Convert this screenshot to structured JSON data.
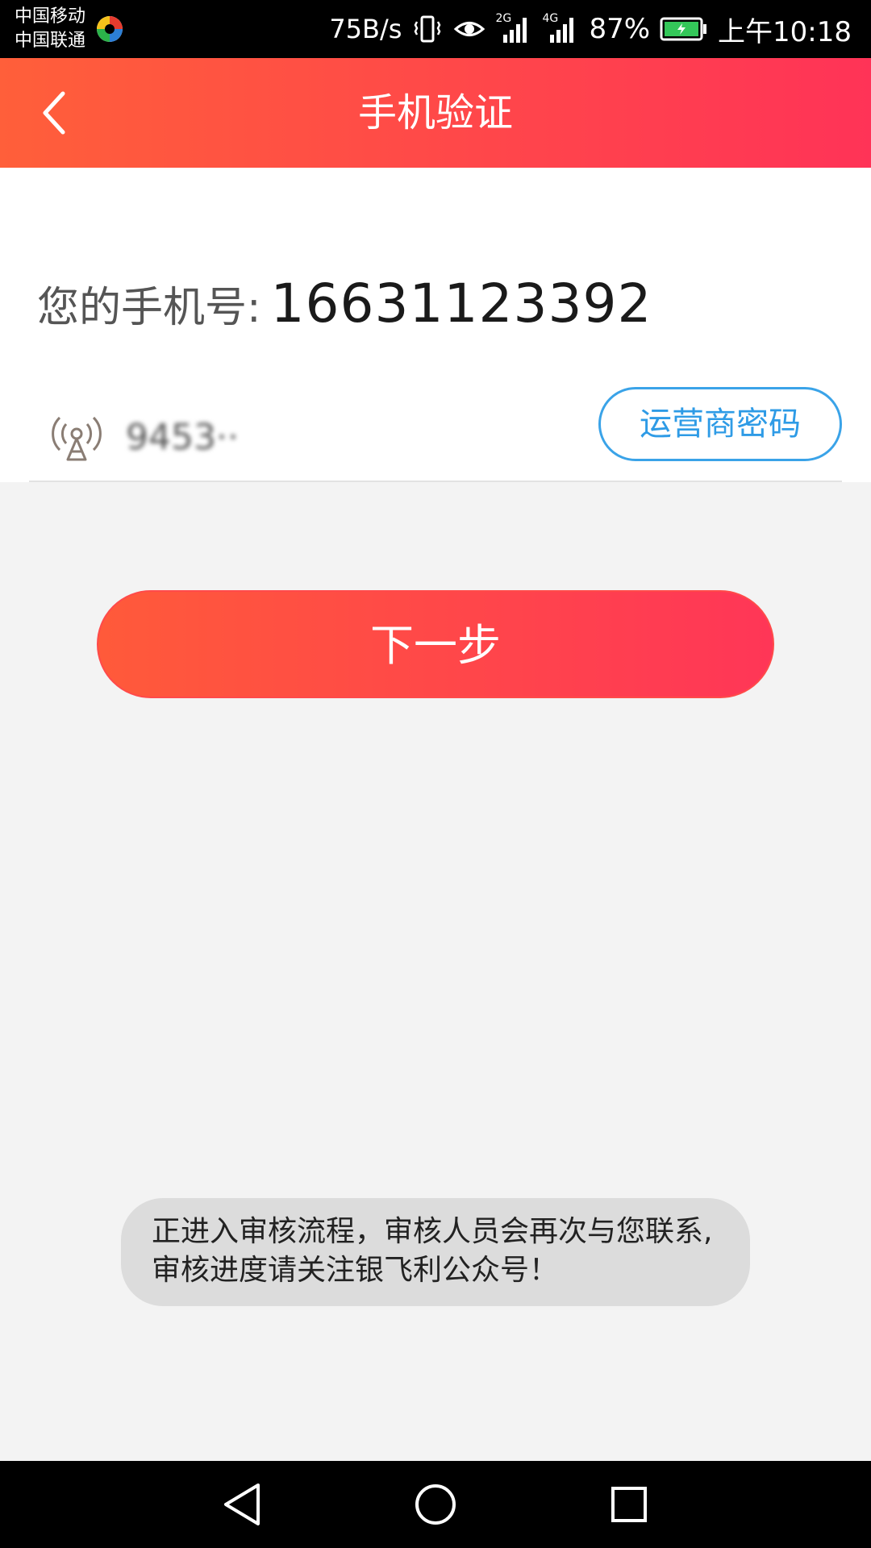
{
  "status_bar": {
    "carrier_1": "中国移动",
    "carrier_2": "中国联通",
    "net_speed": "75B/s",
    "signal_1_label": "2G",
    "signal_2_label": "4G",
    "battery": "87%",
    "time": "上午10:18"
  },
  "header": {
    "title": "手机验证"
  },
  "form": {
    "phone_label": "您的手机号:",
    "phone_number": "16631123392",
    "password_value": "9453··",
    "operator_button": "运营商密码"
  },
  "actions": {
    "next_label": "下一步"
  },
  "toast": {
    "message": "正进入审核流程，审核人员会再次与您联系,审核进度请关注银飞利公众号！"
  },
  "colors": {
    "header_gradient_start": "#ff5f3a",
    "header_gradient_end": "#ff3357",
    "accent_blue": "#2e9be6",
    "background": "#f3f3f3"
  },
  "icons": {
    "back": "chevron-left-icon",
    "operator": "antenna-icon",
    "nav_back": "triangle-back-icon",
    "nav_home": "circle-home-icon",
    "nav_recent": "square-recent-icon"
  }
}
